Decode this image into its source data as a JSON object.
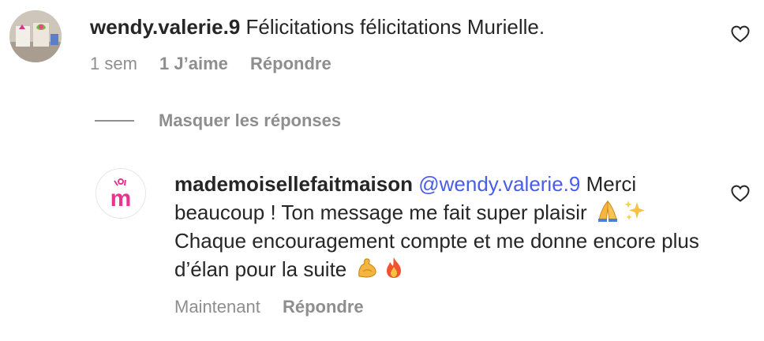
{
  "comment": {
    "username": "wendy.valerie.9",
    "text": "Félicitations félicitations Murielle.",
    "time": "1 sem",
    "likes": "1 J’aime",
    "reply_label": "Répondre",
    "heart_icon": "heart-outline-icon"
  },
  "replies_toggle": {
    "label": "Masquer les réponses"
  },
  "reply": {
    "username": "mademoiselle­faitmaison",
    "mention": "@wendy.valerie.9",
    "text_1": " Merci beaucoup ! Ton message me fait super plaisir ",
    "text_2": " Chaque encouragement compte et me donne encore plus d’élan pour la suite ",
    "emoji_1": "folded-hands-emoji",
    "emoji_2": "sparkles-emoji",
    "emoji_3": "flexed-biceps-emoji",
    "emoji_4": "fire-emoji",
    "time": "Maintenant",
    "reply_label": "Répondre",
    "heart_icon": "heart-outline-icon",
    "avatar_letter": "m"
  },
  "colors": {
    "text": "#262626",
    "muted": "#8e8e8e",
    "mention": "#4a5de8",
    "brand_pink": "#e8338f"
  }
}
